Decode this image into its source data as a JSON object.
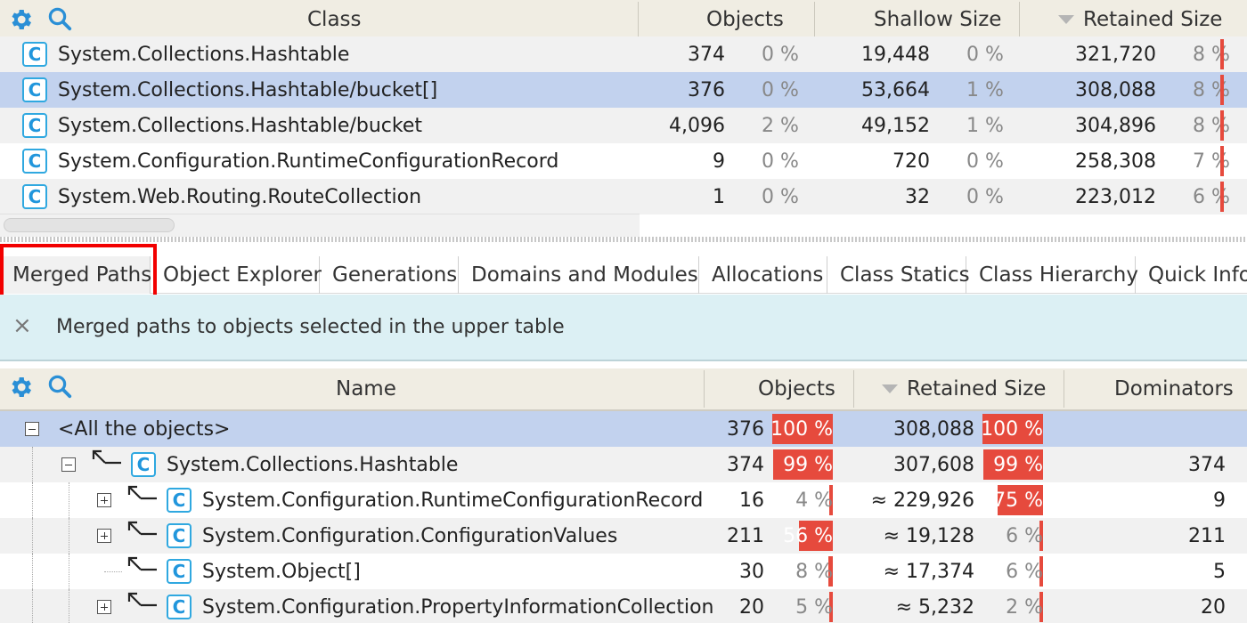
{
  "upper": {
    "columns": {
      "class": "Class",
      "objects": "Objects",
      "shallow": "Shallow Size",
      "retained": "Retained Size"
    },
    "rows": [
      {
        "name": "System.Collections.Hashtable",
        "objects": "374",
        "objects_pct": "0 %",
        "shallow": "19,448",
        "shallow_pct": "0 %",
        "retained": "321,720",
        "retained_pct": "8 %"
      },
      {
        "name": "System.Collections.Hashtable/bucket[]",
        "objects": "376",
        "objects_pct": "0 %",
        "shallow": "53,664",
        "shallow_pct": "1 %",
        "retained": "308,088",
        "retained_pct": "8 %"
      },
      {
        "name": "System.Collections.Hashtable/bucket",
        "objects": "4,096",
        "objects_pct": "2 %",
        "shallow": "49,152",
        "shallow_pct": "1 %",
        "retained": "304,896",
        "retained_pct": "8 %"
      },
      {
        "name": "System.Configuration.RuntimeConfigurationRecord",
        "objects": "9",
        "objects_pct": "0 %",
        "shallow": "720",
        "shallow_pct": "0 %",
        "retained": "258,308",
        "retained_pct": "7 %"
      },
      {
        "name": "System.Web.Routing.RouteCollection",
        "objects": "1",
        "objects_pct": "0 %",
        "shallow": "32",
        "shallow_pct": "0 %",
        "retained": "223,012",
        "retained_pct": "6 %"
      }
    ]
  },
  "tabs": [
    "Merged Paths",
    "Object Explorer",
    "Generations",
    "Domains and Modules",
    "Allocations",
    "Class Statics",
    "Class Hierarchy",
    "Quick Info"
  ],
  "info": {
    "text": "Merged paths to objects selected in the upper table",
    "close": "×"
  },
  "lower": {
    "columns": {
      "name": "Name",
      "objects": "Objects",
      "retained": "Retained Size",
      "dominators": "Dominators"
    },
    "rows": [
      {
        "name": "<All the objects>",
        "objects": "376",
        "objects_pct": "100 %",
        "objects_frac": 1.0,
        "retained": "308,088",
        "retained_pct": "100 %",
        "retained_frac": 1.0,
        "dominators": ""
      },
      {
        "name": "System.Collections.Hashtable",
        "objects": "374",
        "objects_pct": "99 %",
        "objects_frac": 0.99,
        "retained": "307,608",
        "retained_pct": "99 %",
        "retained_frac": 0.99,
        "dominators": "374"
      },
      {
        "name": "System.Configuration.RuntimeConfigurationRecord",
        "objects": "16",
        "objects_pct": "4 %",
        "objects_frac": 0.04,
        "retained": "≈ 229,926",
        "retained_pct": "75 %",
        "retained_frac": 0.75,
        "dominators": "9"
      },
      {
        "name": "System.Configuration.ConfigurationValues",
        "objects": "211",
        "objects_pct": "56 %",
        "objects_frac": 0.56,
        "retained": "≈ 19,128",
        "retained_pct": "6 %",
        "retained_frac": 0.06,
        "dominators": "211"
      },
      {
        "name": "System.Object[]",
        "objects": "30",
        "objects_pct": "8 %",
        "objects_frac": 0.08,
        "retained": "≈ 17,374",
        "retained_pct": "6 %",
        "retained_frac": 0.06,
        "dominators": "5"
      },
      {
        "name": "System.Configuration.PropertyInformationCollection",
        "objects": "20",
        "objects_pct": "5 %",
        "objects_frac": 0.05,
        "retained": "≈ 5,232",
        "retained_pct": "2 %",
        "retained_frac": 0.02,
        "dominators": "20"
      }
    ]
  },
  "colors": {
    "accent": "#2196dc",
    "bar": "#e64a3d",
    "selection": "#c2d2ee",
    "info_bg": "#dcf0f4",
    "highlight": "#f20000"
  },
  "icons": {
    "settings": "gear-icon",
    "search": "search-icon",
    "class": "class-icon",
    "close": "close-icon",
    "sort": "sort-desc-icon"
  }
}
